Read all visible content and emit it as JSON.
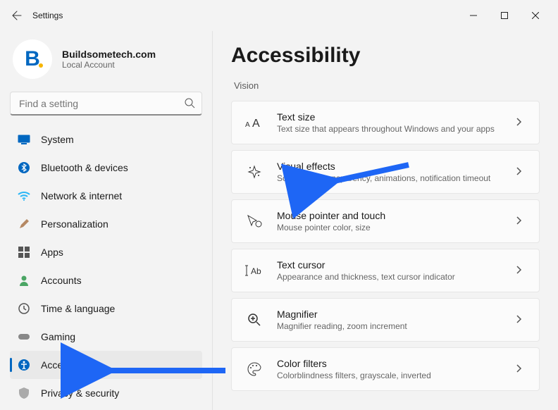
{
  "window": {
    "title": "Settings"
  },
  "account": {
    "avatarLetter": "B",
    "name": "Buildsometech.com",
    "sub": "Local Account"
  },
  "search": {
    "placeholder": "Find a setting"
  },
  "sidebar": [
    {
      "label": "System"
    },
    {
      "label": "Bluetooth & devices"
    },
    {
      "label": "Network & internet"
    },
    {
      "label": "Personalization"
    },
    {
      "label": "Apps"
    },
    {
      "label": "Accounts"
    },
    {
      "label": "Time & language"
    },
    {
      "label": "Gaming"
    },
    {
      "label": "Accessibility"
    },
    {
      "label": "Privacy & security"
    }
  ],
  "page": {
    "title": "Accessibility",
    "section": "Vision"
  },
  "cards": [
    {
      "title": "Text size",
      "sub": "Text size that appears throughout Windows and your apps"
    },
    {
      "title": "Visual effects",
      "sub": "Scroll bars, transparency, animations, notification timeout"
    },
    {
      "title": "Mouse pointer and touch",
      "sub": "Mouse pointer color, size"
    },
    {
      "title": "Text cursor",
      "sub": "Appearance and thickness, text cursor indicator"
    },
    {
      "title": "Magnifier",
      "sub": "Magnifier reading, zoom increment"
    },
    {
      "title": "Color filters",
      "sub": "Colorblindness filters, grayscale, inverted"
    }
  ],
  "colors": {
    "accent": "#0067c0",
    "arrow": "#1e66f5"
  }
}
